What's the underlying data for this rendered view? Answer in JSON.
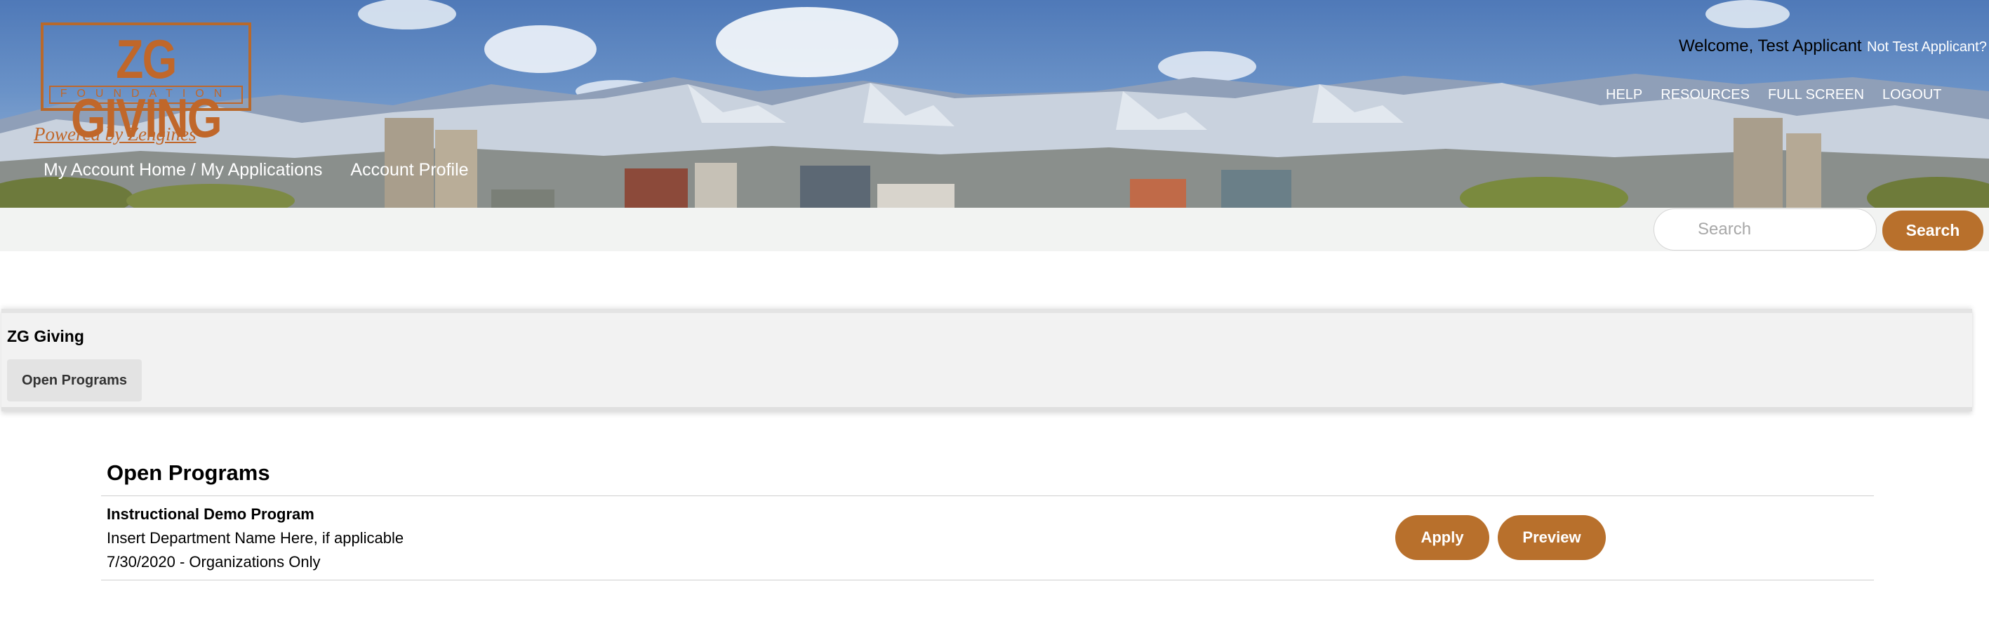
{
  "logo": {
    "title": "ZG GIVING",
    "subtitle": "FOUNDATION",
    "tagline": "Powered by Zengines"
  },
  "header": {
    "welcome_text": "Welcome, Test Applicant",
    "not_user_link": "Not Test Applicant?",
    "top_nav": [
      "HELP",
      "RESOURCES",
      "FULL SCREEN",
      "LOGOUT"
    ],
    "sub_nav": [
      "My Account Home / My Applications",
      "Account Profile"
    ]
  },
  "search": {
    "placeholder": "Search",
    "button_label": "Search"
  },
  "panel": {
    "org_name": "ZG Giving",
    "tab_label": "Open Programs"
  },
  "programs": {
    "heading": "Open Programs",
    "items": [
      {
        "name": "Instructional Demo Program",
        "department": "Insert Department Name Here, if applicable",
        "date_line": "7/30/2020 - Organizations Only",
        "apply_label": "Apply",
        "preview_label": "Preview"
      }
    ]
  },
  "colors": {
    "accent": "#b8702c",
    "logo": "#c0672a",
    "sky": "#5a82bd",
    "strip": "#f2f3f2"
  }
}
